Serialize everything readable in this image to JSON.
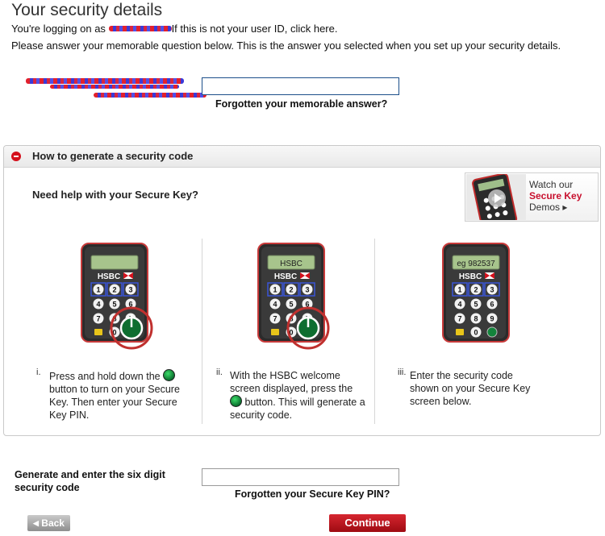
{
  "header": {
    "title": "Your security details",
    "logon_prefix": "You're logging on as",
    "logon_suffix": "If this is not your user ID, click here.",
    "instruction": "Please answer your memorable question below. This is the answer you selected when you set up your security details."
  },
  "memorable": {
    "answer_value": "",
    "forgot_link": "Forgotten your memorable answer?"
  },
  "panel": {
    "title": "How to generate a security code",
    "help_heading": "Need help with your Secure Key?",
    "demo": {
      "line1": "Watch our",
      "line2": "Secure Key",
      "line3": "Demos ▸",
      "device_brand": "HSBC"
    },
    "steps": [
      {
        "numeral": "i.",
        "text_before": "Press and hold down the",
        "text_after": "button to turn on your Secure Key. Then enter your Secure Key PIN.",
        "screen": "",
        "brand": "HSBC"
      },
      {
        "numeral": "ii.",
        "text_before": "With the HSBC welcome screen displayed, press the",
        "text_after": "button. This will generate a security code.",
        "screen": "HSBC",
        "brand": "HSBC"
      },
      {
        "numeral": "iii.",
        "text_before": "Enter the security code shown on your Secure Key screen below.",
        "text_after": "",
        "screen": "eg 982537",
        "brand": "HSBC"
      }
    ],
    "keys": [
      "1",
      "2",
      "3",
      "4",
      "5",
      "6",
      "7",
      "8",
      "9",
      "",
      "0",
      ""
    ]
  },
  "security_code": {
    "label_line1": "Generate and enter the six digit",
    "label_line2": "security code",
    "value": "",
    "forgot_link": "Forgotten your Secure Key PIN?"
  },
  "actions": {
    "back_label": "Back",
    "continue_label": "Continue"
  },
  "colors": {
    "brand_red": "#d4101c",
    "button_grey": "#a8a8a8"
  }
}
